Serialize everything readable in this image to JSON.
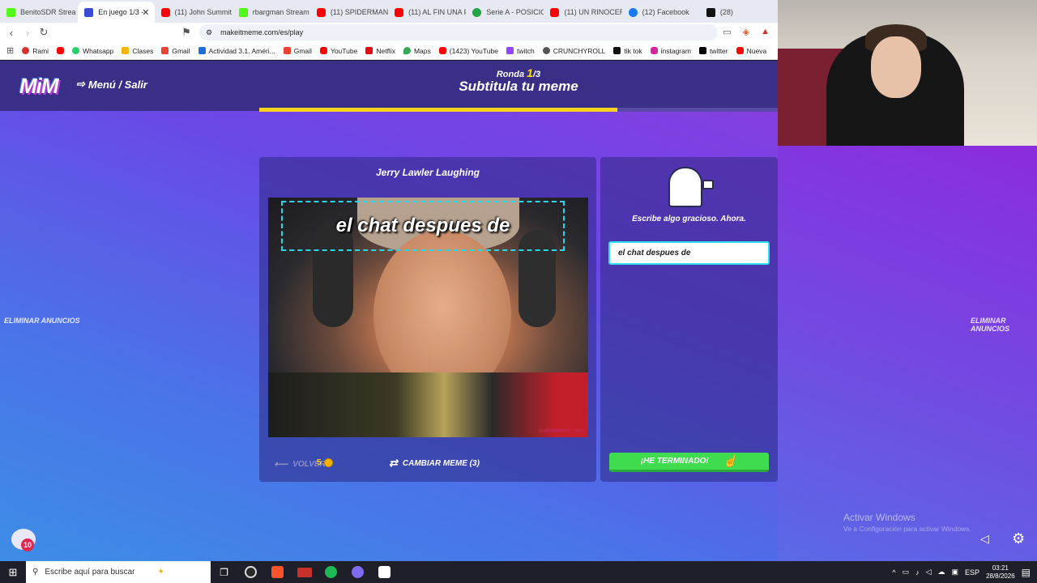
{
  "browser": {
    "tabs": [
      {
        "label": "BenitoSDR Strea",
        "icon": "kick-icon"
      },
      {
        "label": "En juego 1/3 -",
        "icon": "makeitmeme-icon",
        "active": true
      },
      {
        "label": "(11) John Summit -",
        "icon": "youtube-icon"
      },
      {
        "label": "rbargman Stream -",
        "icon": "kick-icon"
      },
      {
        "label": "(11) SPIDERMAN P",
        "icon": "youtube-icon"
      },
      {
        "label": "(11) AL FIN UNA P",
        "icon": "youtube-icon"
      },
      {
        "label": "Serie A - POSICIO",
        "icon": "globe-icon"
      },
      {
        "label": "(11) UN RINOCERO",
        "icon": "youtube-icon"
      },
      {
        "label": "(12) Facebook",
        "icon": "facebook-icon"
      },
      {
        "label": "(28)",
        "icon": "tiktok-icon"
      }
    ],
    "url": "makeitmeme.com/es/play",
    "bookmarks": [
      {
        "label": "Rami",
        "icon": "fav-red"
      },
      {
        "label": "",
        "icon": "fav-yt"
      },
      {
        "label": "Whatsapp",
        "icon": "fav-wa"
      },
      {
        "label": "Clases",
        "icon": "fav-cl"
      },
      {
        "label": "Gmail",
        "icon": "fav-gm"
      },
      {
        "label": "Actividad 3.1. Améri...",
        "icon": "fav-sheet"
      },
      {
        "label": "Gmail",
        "icon": "fav-gm"
      },
      {
        "label": "YouTube",
        "icon": "fav-yt"
      },
      {
        "label": "Netflix",
        "icon": "fav-nf"
      },
      {
        "label": "Maps",
        "icon": "fav-map"
      },
      {
        "label": "(1423) YouTube",
        "icon": "fav-yt"
      },
      {
        "label": "twitch",
        "icon": "fav-tw"
      },
      {
        "label": "CRUNCHYROLL",
        "icon": "fav-cr"
      },
      {
        "label": "tik tok",
        "icon": "fav-tt"
      },
      {
        "label": "instagram",
        "icon": "fav-ig"
      },
      {
        "label": "twitter",
        "icon": "fav-x"
      },
      {
        "label": "Nueva",
        "icon": "fav-yt"
      }
    ]
  },
  "game": {
    "logo": "MiM",
    "menu_label": "Menú / Salir",
    "round_prefix": "Ronda ",
    "round_current": "1",
    "round_total": "/3",
    "phase_title": "Subtitula tu meme",
    "progress": 0.69,
    "ad_left": "ELIMINAR ANUNCIOS",
    "ad_right": "ELIMINAR ANUNCIOS",
    "meme_title": "Jerry Lawler Laughing",
    "caption": "el chat despues de",
    "watermark": "makeitmeme.com",
    "back_label": "VOLVER",
    "coins": "5",
    "change_meme_label": "CAMBIAR MEME (3)",
    "instruction": "Escribe algo gracioso. Ahora.",
    "input_value": "el chat despues de ",
    "done_label": "¡HE TERMINADO!",
    "chat_badge": "10"
  },
  "windows": {
    "activate_title": "Activar Windows",
    "activate_sub": "Ve a Configuración para activar Windows.",
    "search_placeholder": "Escribe aquí para buscar",
    "language": "ESP",
    "time": "03:21",
    "date": "28/8/2026"
  },
  "colors": {
    "accent_yellow": "#ffd21c",
    "done_green": "#3fdc50",
    "caption_box": "#28d6e8"
  }
}
